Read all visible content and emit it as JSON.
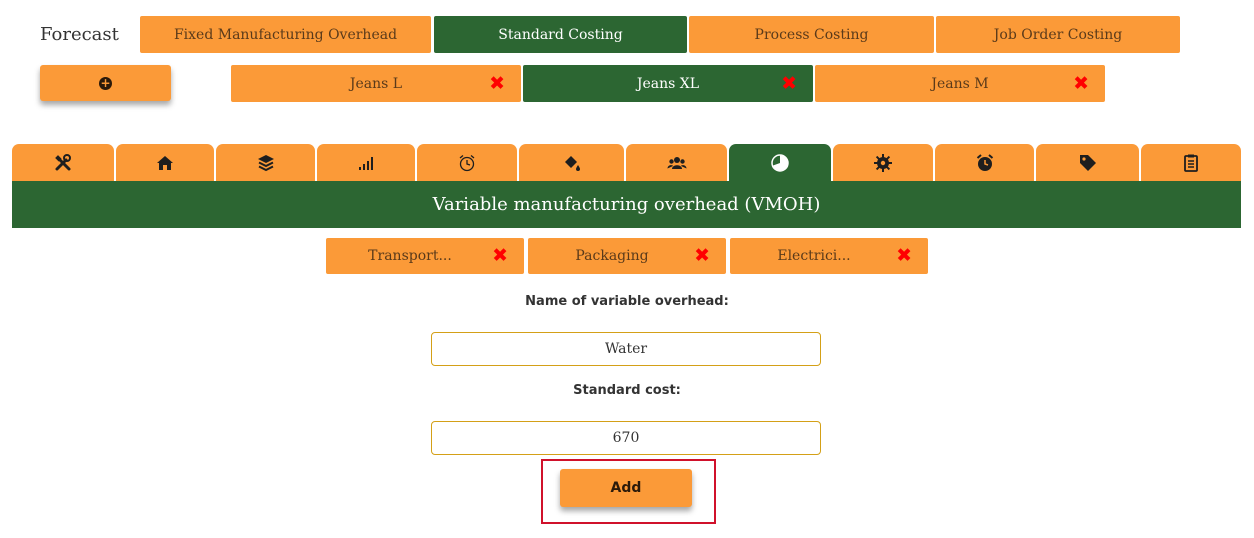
{
  "app": {
    "title": "Forecast"
  },
  "top_tabs": [
    {
      "label": "Fixed Manufacturing Overhead",
      "active": false
    },
    {
      "label": "Standard Costing",
      "active": true
    },
    {
      "label": "Process Costing",
      "active": false
    },
    {
      "label": "Job Order Costing",
      "active": false
    }
  ],
  "add_product_icon": "plus-circle-icon",
  "products": [
    {
      "label": "Jeans L",
      "active": false
    },
    {
      "label": "Jeans XL",
      "active": true
    },
    {
      "label": "Jeans M",
      "active": false
    }
  ],
  "category_tabs": [
    {
      "icon": "tools-icon"
    },
    {
      "icon": "home-icon"
    },
    {
      "icon": "layers-icon"
    },
    {
      "icon": "signal-bars-icon"
    },
    {
      "icon": "alarm-clock-outline-icon"
    },
    {
      "icon": "paint-bucket-icon"
    },
    {
      "icon": "users-icon"
    },
    {
      "icon": "pie-chart-icon",
      "active": true
    },
    {
      "icon": "cog-icon"
    },
    {
      "icon": "alarm-clock-icon"
    },
    {
      "icon": "tags-icon"
    },
    {
      "icon": "clipboard-icon"
    }
  ],
  "banner": {
    "title": "Variable manufacturing overhead (VMOH)"
  },
  "overheads": [
    {
      "label": "Transport..."
    },
    {
      "label": "Packaging"
    },
    {
      "label": "Electrici..."
    }
  ],
  "form": {
    "name_label": "Name of variable overhead:",
    "name_value": "Water",
    "cost_label": "Standard cost:",
    "cost_value": "670",
    "add_label": "Add"
  },
  "colors": {
    "orange": "#fb9a38",
    "green": "#2c6632",
    "remove": "#ff0000",
    "highlight": "#d0112b"
  }
}
